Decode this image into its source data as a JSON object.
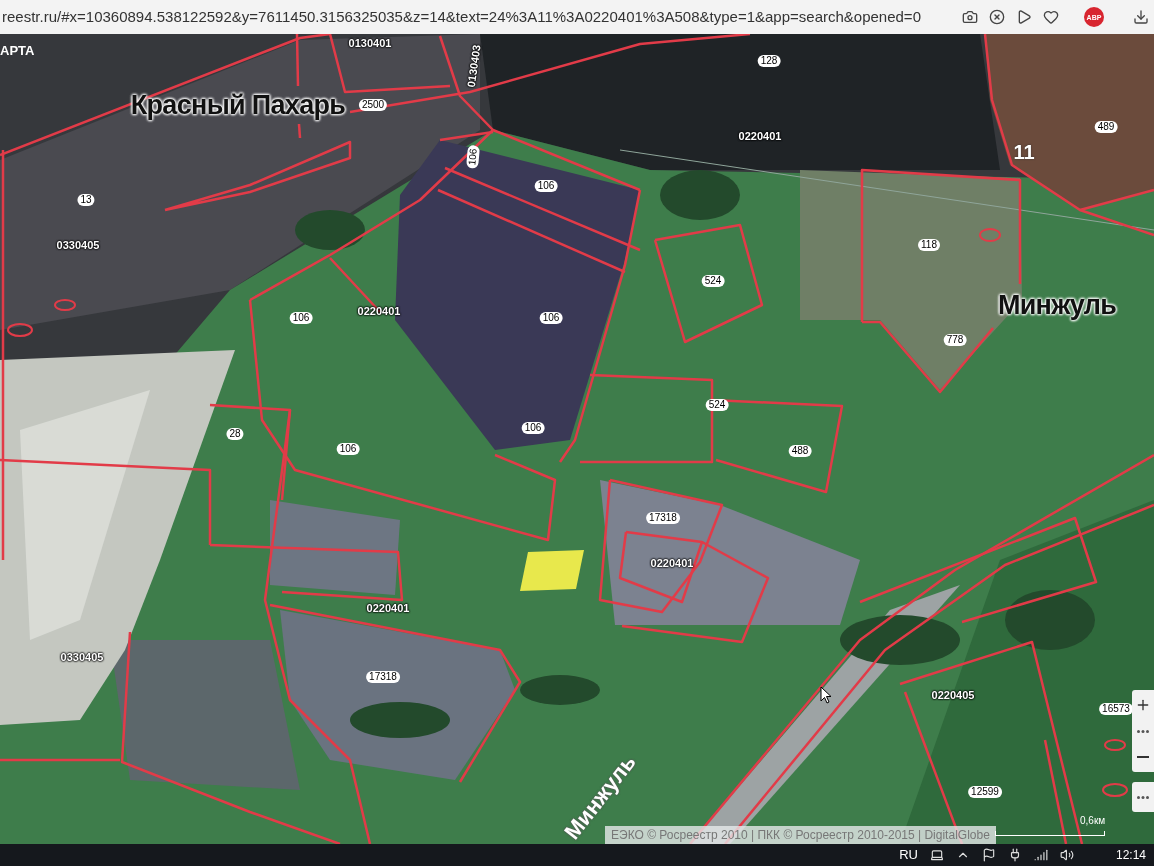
{
  "browser": {
    "url": "reestr.ru/#x=10360894.538122592&y=7611450.3156325035&z=14&text=24%3A11%3A0220401%3A508&type=1&app=search&opened=0",
    "extension_badge": "ABP"
  },
  "map": {
    "layer_button": "АРТА",
    "labels": [
      {
        "kind": "quarter",
        "text": "0130401"
      },
      {
        "kind": "quarter",
        "text": "0130403"
      },
      {
        "kind": "place",
        "text": "Красный Пахарь"
      },
      {
        "kind": "parcel",
        "text": "2500"
      },
      {
        "kind": "parcel",
        "text": "128"
      },
      {
        "kind": "quarter",
        "text": "0220401"
      },
      {
        "kind": "parcel",
        "text": "489"
      },
      {
        "kind": "area",
        "text": "11"
      },
      {
        "kind": "parcel",
        "text": "13"
      },
      {
        "kind": "quarter",
        "text": "0330405"
      },
      {
        "kind": "parcel",
        "text": "106"
      },
      {
        "kind": "parcel",
        "text": "106"
      },
      {
        "kind": "parcel",
        "text": "106"
      },
      {
        "kind": "quarter",
        "text": "0220401"
      },
      {
        "kind": "parcel",
        "text": "106"
      },
      {
        "kind": "parcel",
        "text": "524"
      },
      {
        "kind": "parcel",
        "text": "118"
      },
      {
        "kind": "place",
        "text": "Минжуль"
      },
      {
        "kind": "parcel",
        "text": "778"
      },
      {
        "kind": "parcel",
        "text": "524"
      },
      {
        "kind": "parcel",
        "text": "106"
      },
      {
        "kind": "parcel",
        "text": "488"
      },
      {
        "kind": "parcel",
        "text": "28"
      },
      {
        "kind": "parcel",
        "text": "106"
      },
      {
        "kind": "parcel",
        "text": "17318"
      },
      {
        "kind": "quarter",
        "text": "0220401"
      },
      {
        "kind": "quarter",
        "text": "0220401"
      },
      {
        "kind": "quarter",
        "text": "0330405"
      },
      {
        "kind": "parcel",
        "text": "17318"
      },
      {
        "kind": "quarter",
        "text": "0220405"
      },
      {
        "kind": "parcel",
        "text": "16573"
      },
      {
        "kind": "parcel",
        "text": "12599"
      },
      {
        "kind": "river",
        "text": "Минжуль"
      }
    ],
    "attribution": "ЕЭКО © Росреестр 2010 | ПКК © Росреестр 2010-2015 | DigitalGlobe",
    "scale": "0,6км"
  },
  "taskbar": {
    "language": "RU",
    "time": "12:14"
  }
}
